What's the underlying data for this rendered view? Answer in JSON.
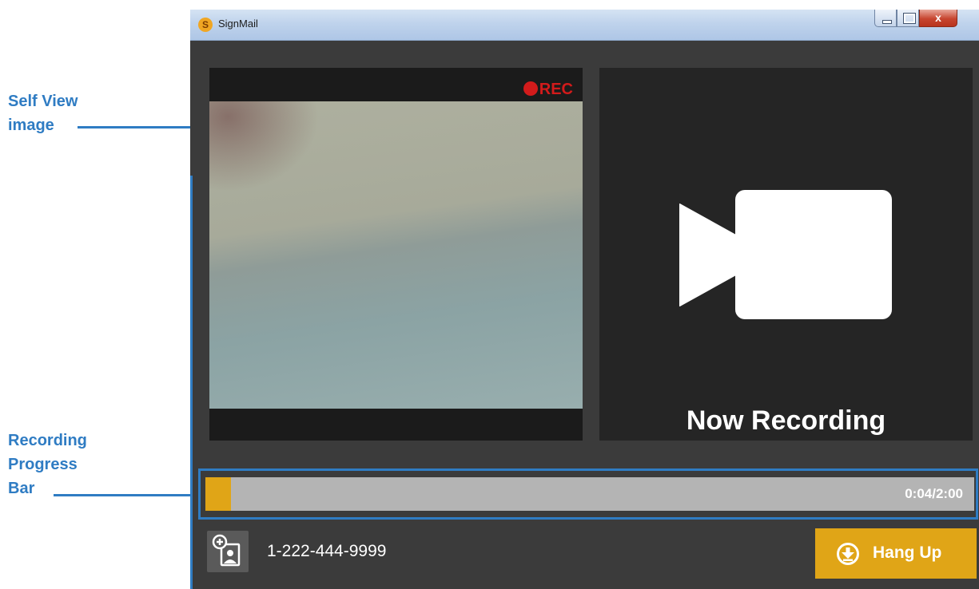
{
  "annotations": {
    "self_view": [
      "Self View",
      "image"
    ],
    "progress_bar": [
      "Recording",
      "Progress",
      "Bar"
    ]
  },
  "window": {
    "title": "SignMail",
    "app_icon_letter": "S",
    "close_glyph": "x"
  },
  "self_view": {
    "rec_label": "REC",
    "rec_color": "#d21b1b"
  },
  "remote_view": {
    "icon": "video-camera-icon",
    "status": "Now Recording"
  },
  "progress": {
    "elapsed_fraction": 0.033,
    "time_text": "0:04/2:00",
    "fill_color": "#e0a517"
  },
  "footer": {
    "contact_icon": "add-contact-icon",
    "phone_number": "1-222-444-9999",
    "hangup_label": "Hang Up",
    "hangup_icon": "download-circle-icon",
    "accent": "#e0a517"
  },
  "colors": {
    "annotation": "#2f7cc3",
    "window_bg": "#3b3b3b"
  }
}
